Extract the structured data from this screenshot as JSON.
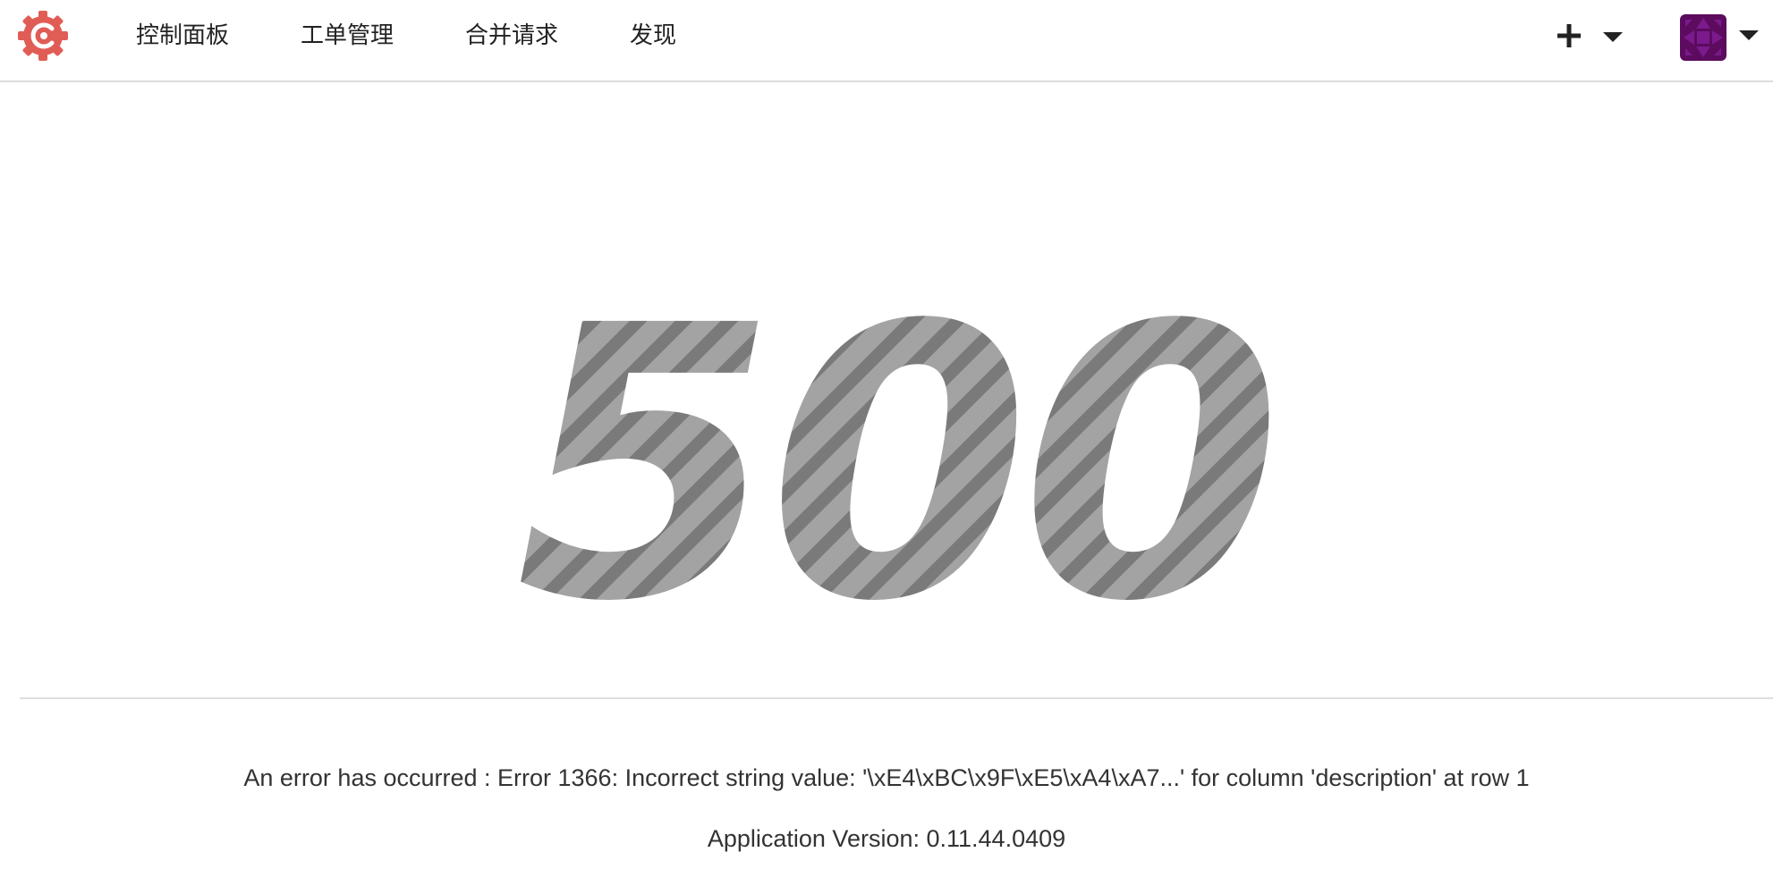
{
  "nav": {
    "items": [
      {
        "label": "控制面板"
      },
      {
        "label": "工单管理"
      },
      {
        "label": "合并请求"
      },
      {
        "label": "发现"
      }
    ]
  },
  "header": {
    "logo_icon": "gitea-logo-icon",
    "create_icon": "plus-icon",
    "user_avatar_icon": "avatar-icon"
  },
  "error": {
    "code": "500",
    "message": "An error has occurred : Error 1366: Incorrect string value: '\\xE4\\xBC\\x9F\\xE5\\xA4\\xA7...' for column 'description' at row 1",
    "version": "Application Version: 0.11.44.0409"
  },
  "colors": {
    "logo": "#e05d56",
    "avatar": "#5c0b5e",
    "pattern_light": "#a3a3a3",
    "pattern_dark": "#7a7a7a"
  }
}
